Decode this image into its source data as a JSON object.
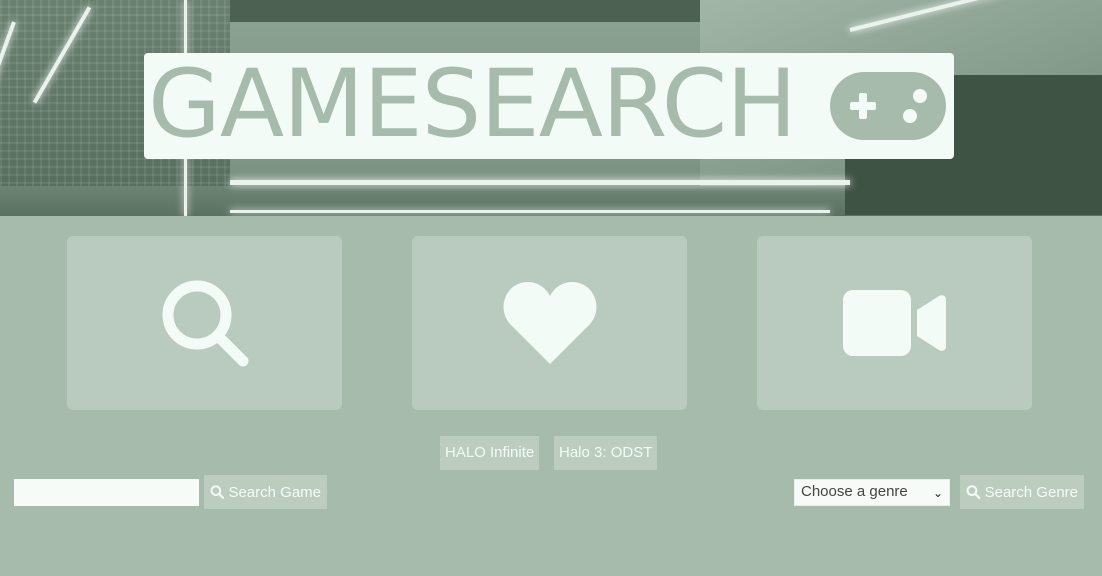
{
  "header": {
    "logo_text": "GAMESEARCH",
    "logo_icon": "gamepad-icon"
  },
  "tiles": [
    {
      "name": "search-tile",
      "icon": "search-icon"
    },
    {
      "name": "favorites-tile",
      "icon": "heart-icon"
    },
    {
      "name": "videos-tile",
      "icon": "video-camera-icon"
    }
  ],
  "recent_searches": [
    "HALO Infinite",
    "Halo 3: ODST"
  ],
  "search": {
    "input_value": "",
    "button_label": "Search Game",
    "button_icon": "search-icon"
  },
  "genre": {
    "selected": "Choose a genre",
    "button_label": "Search Genre",
    "button_icon": "search-icon"
  },
  "colors": {
    "background": "#a7bbad",
    "tile": "#b9cbbe",
    "accent_light": "#f3fbf6"
  }
}
